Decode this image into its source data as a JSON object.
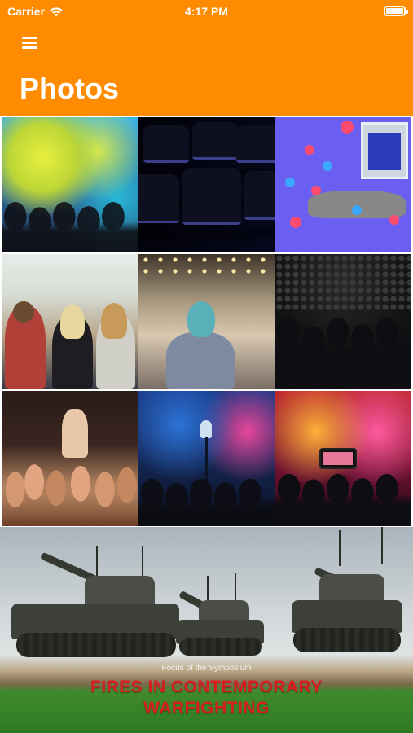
{
  "status_bar": {
    "carrier": "Carrier",
    "time": "4:17 PM",
    "battery_level": 1.0
  },
  "header": {
    "title": "Photos",
    "menu_icon": "hamburger-menu-icon",
    "background_color": "#FF8C00"
  },
  "photos": [
    {
      "subject": "holi-color-festival"
    },
    {
      "subject": "empty-conference-chairs"
    },
    {
      "subject": "social-media-stage-illustration"
    },
    {
      "subject": "outdoor-festival-crowd"
    },
    {
      "subject": "woman-at-conference-hall"
    },
    {
      "subject": "seated-audience-dark-hall"
    },
    {
      "subject": "concert-hands-raised"
    },
    {
      "subject": "stage-microphone-blue-lights"
    },
    {
      "subject": "concert-phone-recording"
    }
  ],
  "banner": {
    "subtitle": "Focus of the Symposium",
    "title_line1": "FIRES IN CONTEMPORARY",
    "title_line2": "WARFIGHTING"
  }
}
